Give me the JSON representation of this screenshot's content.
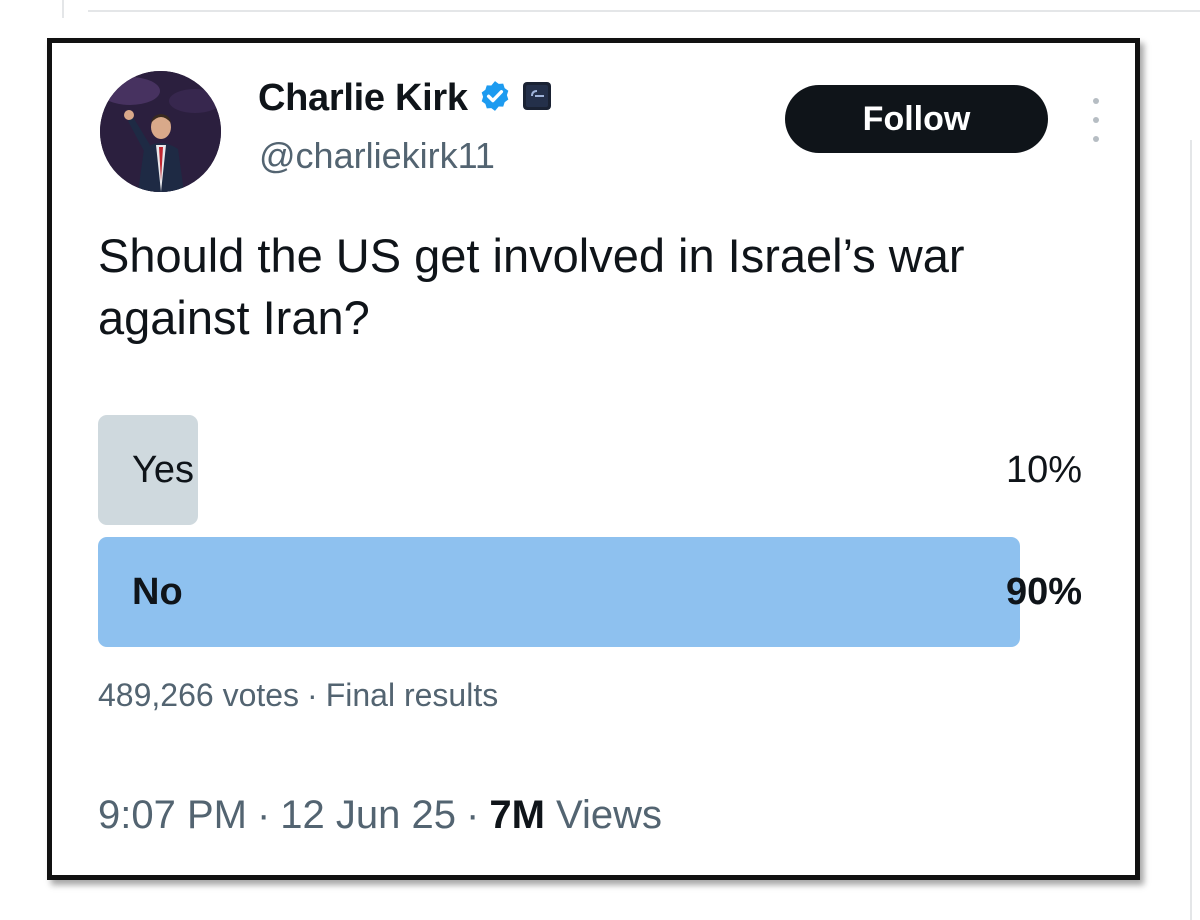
{
  "author": {
    "display_name": "Charlie Kirk",
    "handle": "@charliekirk11",
    "verified_icon": "verified-badge-icon",
    "affiliate_icon": "affiliate-badge-icon"
  },
  "actions": {
    "follow_label": "Follow",
    "more_icon": "more-options-icon"
  },
  "tweet": {
    "text": "Should the US get involved in Israel’s war against Iran?"
  },
  "poll": {
    "options": [
      {
        "label": "Yes",
        "percent_text": "10%",
        "percent": 10,
        "winner": false
      },
      {
        "label": "No",
        "percent_text": "90%",
        "percent": 90,
        "winner": true
      }
    ],
    "votes_text": "489,266 votes",
    "separator": "·",
    "status_text": "Final results"
  },
  "meta": {
    "time": "9:07 PM",
    "date": "12 Jun 25",
    "separator": "·",
    "views_count": "7M",
    "views_label": "Views"
  },
  "colors": {
    "winner_bar": "#8ec1ef",
    "other_bar": "#cfd9de",
    "follow_bg": "#0f1419",
    "verified": "#1d9bf0"
  }
}
